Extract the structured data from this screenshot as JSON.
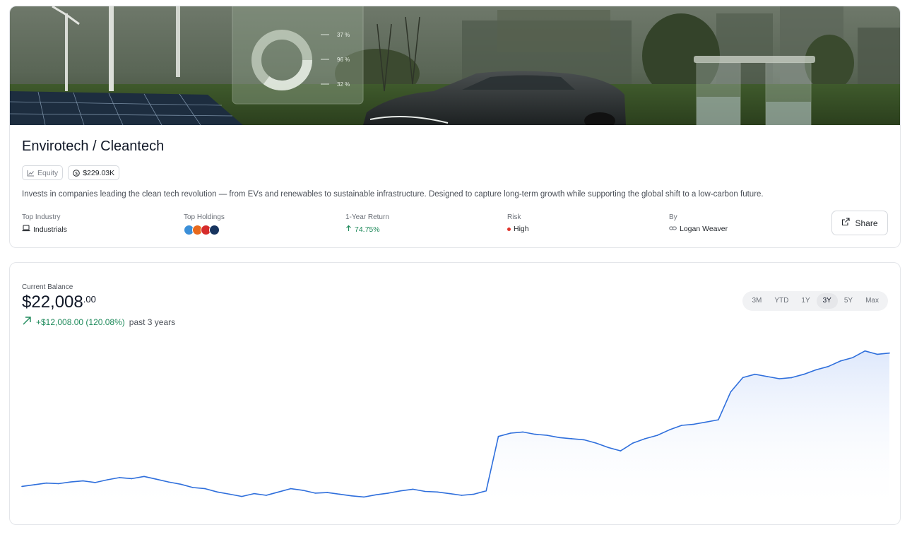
{
  "fund": {
    "title": "Envirotech / Cleantech",
    "tags": {
      "type": "Equity",
      "value": "$229.03K"
    },
    "description": "Invests in companies leading the clean tech revolution — from EVs and renewables to sustainable infrastructure. Designed to capture long-term growth while supporting the global shift to a low-carbon future.",
    "stats": {
      "top_industry": {
        "label": "Top Industry",
        "value": "Industrials"
      },
      "top_holdings": {
        "label": "Top Holdings",
        "colors": [
          "#3b8fd8",
          "#e86a1d",
          "#d62c2c",
          "#16335e"
        ]
      },
      "one_year_return": {
        "label": "1-Year Return",
        "value": "74.75%"
      },
      "risk": {
        "label": "Risk",
        "value": "High"
      },
      "by": {
        "label": "By",
        "value": "Logan Weaver"
      }
    },
    "share_label": "Share",
    "hero_overlay": {
      "readouts": [
        "37 %",
        "96 %",
        "32 %"
      ]
    }
  },
  "balance": {
    "label": "Current Balance",
    "dollars": "$22,008",
    "cents": ".00",
    "change": "+$12,008.00 (120.08%)",
    "period": "past 3 years",
    "ranges": [
      "3M",
      "YTD",
      "1Y",
      "3Y",
      "5Y",
      "Max"
    ],
    "active_range": "3Y"
  },
  "colors": {
    "accent_line": "#2f6fdc",
    "positive": "#1f8a5b",
    "risk": "#e0342b"
  },
  "chart_data": {
    "type": "area",
    "title": "",
    "xlabel": "",
    "ylabel": "",
    "grid": false,
    "series": [
      {
        "values": [
          10000,
          10150,
          10300,
          10250,
          10400,
          10500,
          10350,
          10600,
          10800,
          10700,
          10900,
          10650,
          10400,
          10200,
          9900,
          9800,
          9500,
          9300,
          9100,
          9350,
          9200,
          9500,
          9800,
          9650,
          9400,
          9450,
          9300,
          9150,
          9050,
          9250,
          9400,
          9600,
          9750,
          9550,
          9500,
          9350,
          9200,
          9300,
          9600,
          14500,
          14800,
          14900,
          14700,
          14600,
          14400,
          14300,
          14200,
          13900,
          13500,
          13200,
          13900,
          14300,
          14600,
          15100,
          15500,
          15600,
          15800,
          16000,
          18500,
          19800,
          20100,
          19900,
          19700,
          19800,
          20100,
          20500,
          20800,
          21300,
          21600,
          22200,
          21900,
          22008
        ]
      }
    ]
  }
}
